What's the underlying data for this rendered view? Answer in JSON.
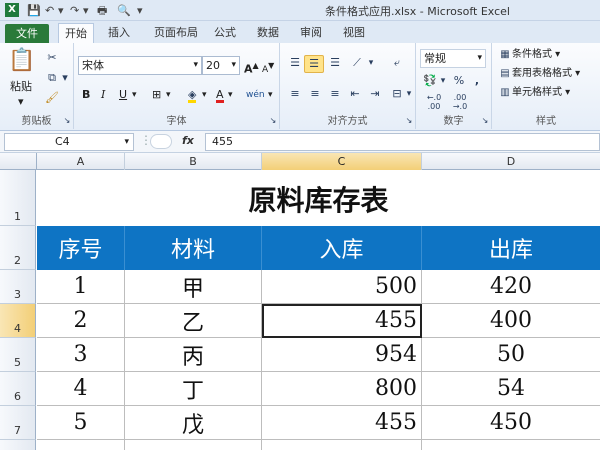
{
  "window": {
    "title": "条件格式应用.xlsx - Microsoft Excel"
  },
  "tabs": [
    {
      "label": "文件"
    },
    {
      "label": "开始"
    },
    {
      "label": "插入"
    },
    {
      "label": "页面布局"
    },
    {
      "label": "公式"
    },
    {
      "label": "数据"
    },
    {
      "label": "审阅"
    },
    {
      "label": "视图"
    }
  ],
  "ribbon": {
    "clipboard": {
      "label": "剪贴板",
      "paste": "粘贴"
    },
    "font": {
      "label": "字体",
      "name": "宋体",
      "size": "20",
      "bold": "B",
      "italic": "I",
      "underline": "U",
      "grow": "A",
      "shrink": "A",
      "color": "A",
      "phonetic": "wén"
    },
    "alignment": {
      "label": "对齐方式"
    },
    "number": {
      "label": "数字",
      "format": "常规",
      "percent": "%"
    },
    "styles": {
      "label": "样式",
      "conditional": "条件格式",
      "table": "套用表格格式",
      "cell": "单元格样式"
    }
  },
  "formula_bar": {
    "name_box": "C4",
    "fx": "fx",
    "value": "455"
  },
  "columns": [
    "A",
    "B",
    "C",
    "D"
  ],
  "rows": [
    "1",
    "2",
    "3",
    "4",
    "5",
    "6",
    "7"
  ],
  "sheet": {
    "title": "原料库存表",
    "headers": [
      "序号",
      "材料",
      "入库",
      "出库"
    ],
    "data": [
      [
        "1",
        "甲",
        "500",
        "420"
      ],
      [
        "2",
        "乙",
        "455",
        "400"
      ],
      [
        "3",
        "丙",
        "954",
        "50"
      ],
      [
        "4",
        "丁",
        "800",
        "54"
      ],
      [
        "5",
        "戊",
        "455",
        "450"
      ]
    ]
  },
  "colors": {
    "file_tab": "#2a7a3a",
    "header_fill": "#0e74c4"
  }
}
